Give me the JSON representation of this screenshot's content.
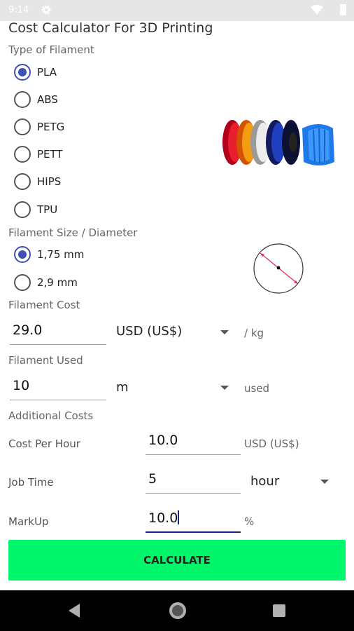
{
  "status": {
    "time": "9:14"
  },
  "app": {
    "title": "Cost Calculator For 3D Printing"
  },
  "filament_type": {
    "label": "Type of Filament",
    "options": [
      "PLA",
      "ABS",
      "PETG",
      "PETT",
      "HIPS",
      "TPU"
    ],
    "selected": "PLA"
  },
  "filament_size": {
    "label": "Filament Size / Diameter",
    "options": [
      "1,75 mm",
      "2,9 mm"
    ],
    "selected": "1,75 mm"
  },
  "filament_cost": {
    "label": "Filament Cost",
    "value": "29.0",
    "currency": "USD (US$)",
    "unit": "/ kg"
  },
  "filament_used": {
    "label": "Filament Used",
    "value": "10",
    "unit_select": "m",
    "suffix": "used"
  },
  "additional_costs": {
    "label": "Additional Costs",
    "cost_per_hour": {
      "label": "Cost Per Hour",
      "value": "10.0",
      "unit": "USD (US$)"
    },
    "job_time": {
      "label": "Job Time",
      "value": "5",
      "unit_select": "hour"
    },
    "markup": {
      "label": "MarkUp",
      "value": "10.0",
      "unit": "%"
    }
  },
  "calculate_label": "CALCULATE",
  "colors": {
    "accent": "#3f51b5",
    "button": "#00f76b",
    "focus_underline": "#1a237e"
  },
  "icons": [
    "settings-gear-icon",
    "wifi-icon",
    "battery-icon",
    "filament-spools-image",
    "diameter-circle-icon",
    "nav-back-icon",
    "nav-home-icon",
    "nav-recent-icon"
  ]
}
